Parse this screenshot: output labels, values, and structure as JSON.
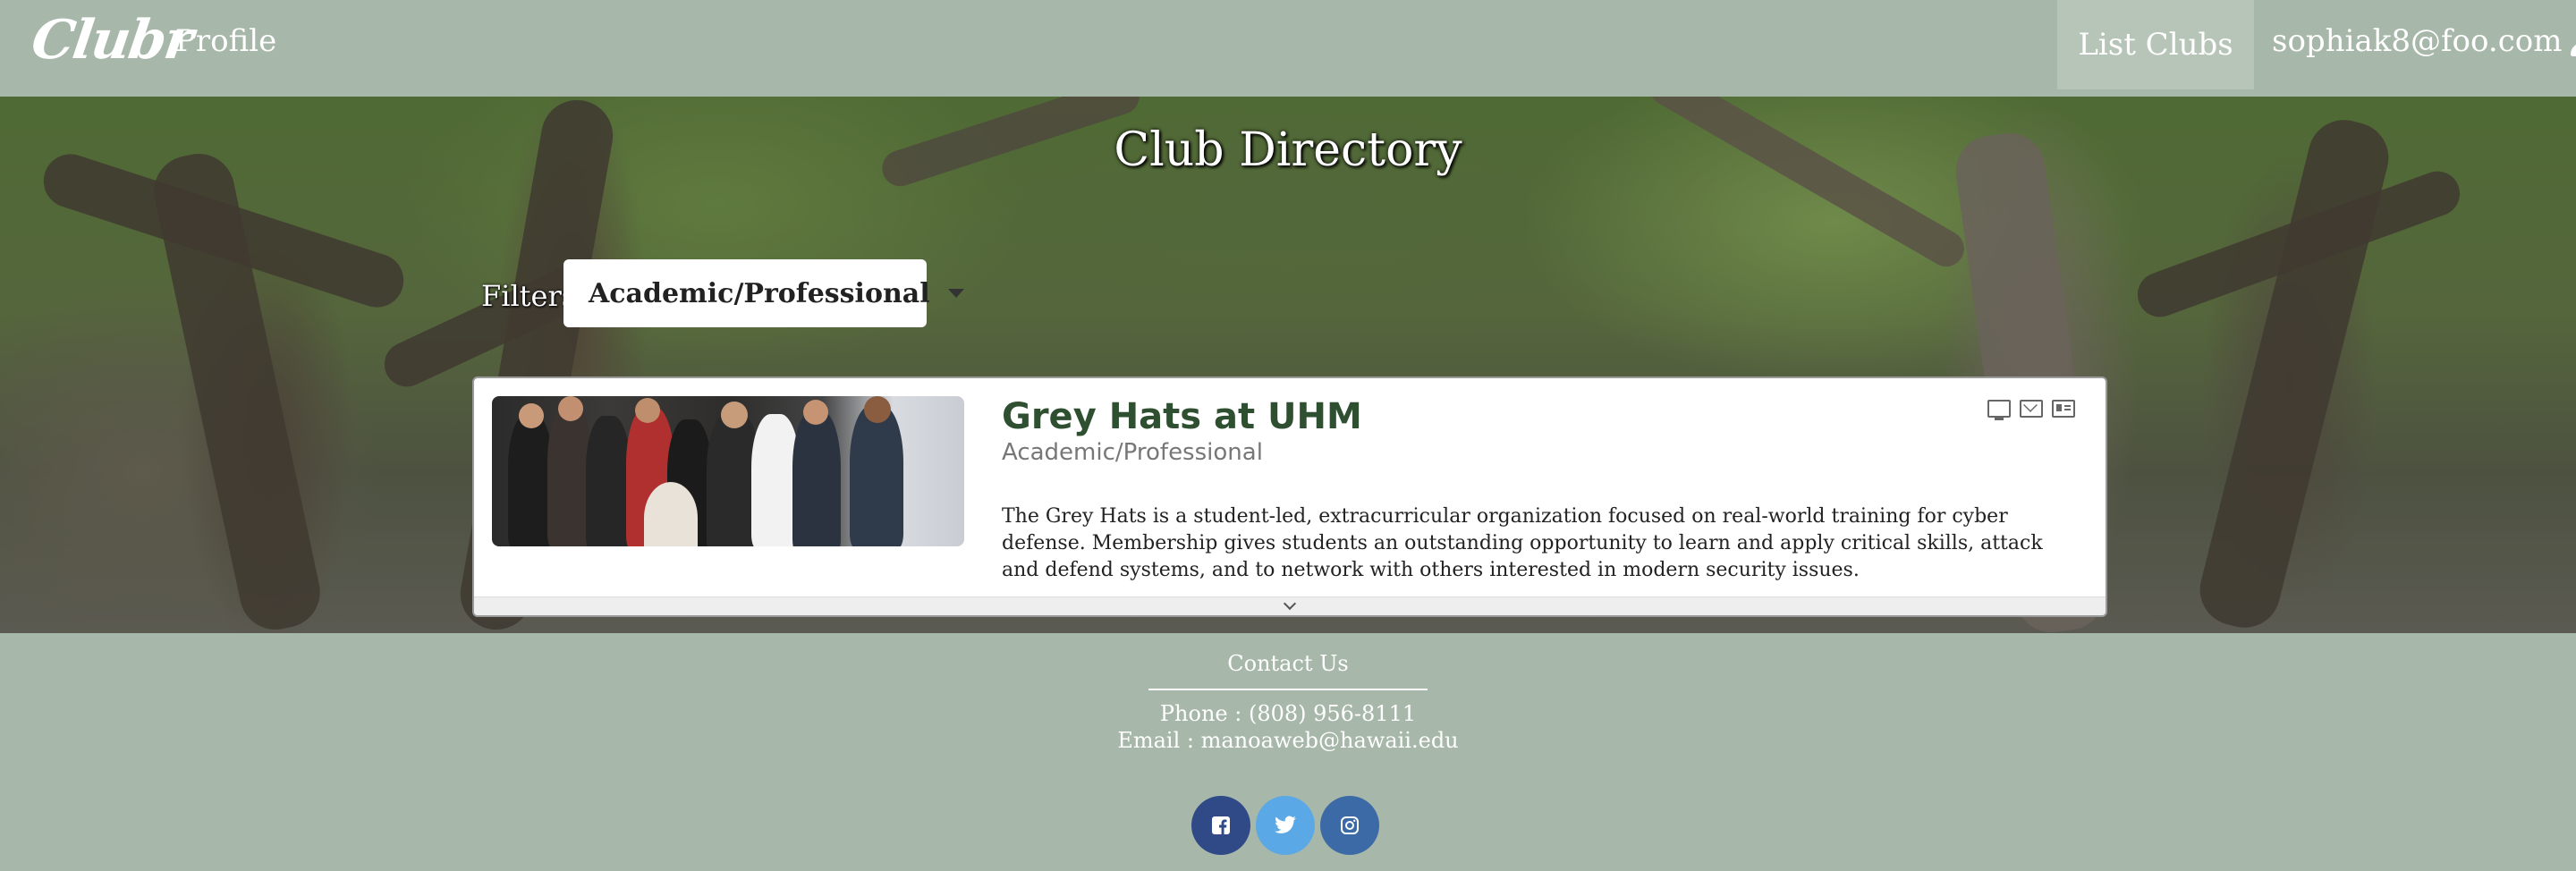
{
  "nav": {
    "logo": "Clubr",
    "profile": "Profile",
    "list_clubs": "List Clubs",
    "user_email": "sophiak8@foo.com"
  },
  "hero": {
    "title": "Club Directory",
    "filters_label": "Filters",
    "filter_value": "Academic/Professional"
  },
  "club": {
    "name": "Grey Hats at UHM",
    "category": "Academic/Professional",
    "description": "The Grey Hats is a student-led, extracurricular organization focused on real-world training for cyber defense. Membership gives students an outstanding opportunity to learn and apply critical skills, attack and defend systems, and to network with others interested in modern security issues.",
    "icons": [
      "monitor-icon",
      "mail-icon",
      "id-card-icon"
    ]
  },
  "footer": {
    "contact_title": "Contact Us",
    "phone": "Phone : (808) 956-8111",
    "email": "Email : manoaweb@hawaii.edu",
    "socials": [
      "facebook-icon",
      "twitter-icon",
      "instagram-icon"
    ]
  },
  "colors": {
    "nav_bg": "#a7b7a9",
    "active_nav_bg": "#b6c5b8",
    "club_name": "#2f4f31",
    "facebook": "#2f4a86",
    "twitter": "#5aa8e6",
    "instagram": "#3c6aa6"
  }
}
